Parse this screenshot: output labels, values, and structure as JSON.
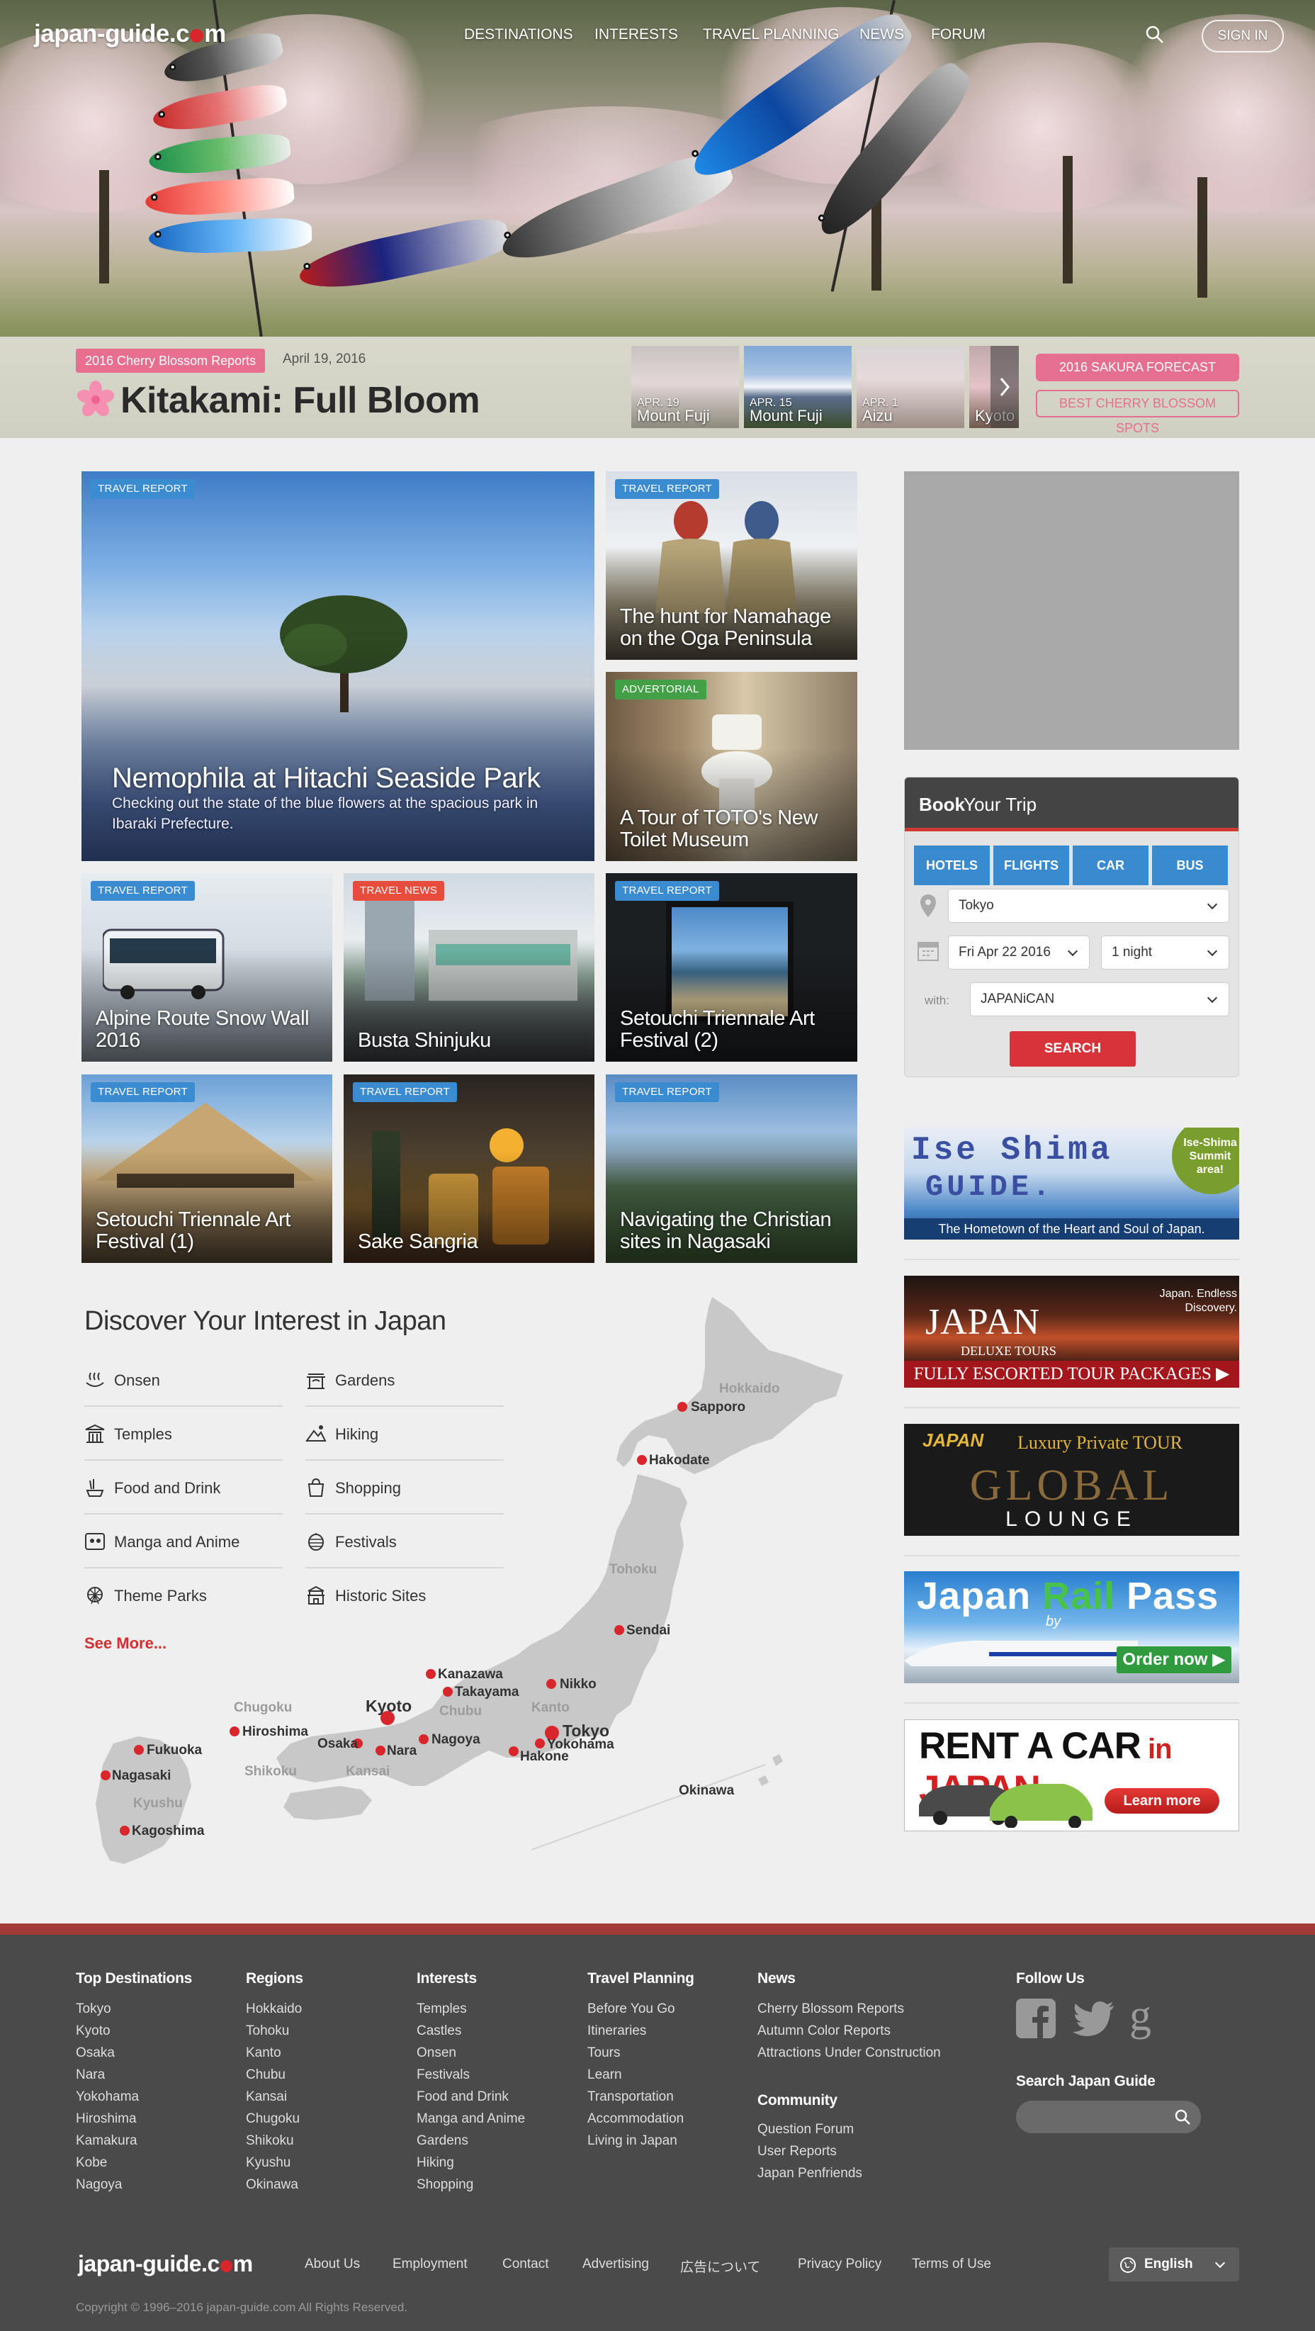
{
  "site": {
    "logo_pre": "japan-guide.c",
    "logo_post": "m",
    "brand_red": "#d8262c"
  },
  "nav": {
    "items": [
      "DESTINATIONS",
      "INTERESTS",
      "TRAVEL PLANNING",
      "NEWS",
      "FORUM"
    ],
    "search_icon": "search-icon",
    "signin": "SIGN IN"
  },
  "feature": {
    "tag": "2016 Cherry Blossom Reports",
    "date": "April 19, 2016",
    "title": "Kitakami: Full Bloom",
    "thumbs": [
      {
        "date": "APR. 19",
        "name": "Mount Fuji"
      },
      {
        "date": "APR. 15",
        "name": "Mount Fuji"
      },
      {
        "date": "APR. 1",
        "name": "Aizu"
      },
      {
        "date": "",
        "name": "Kyoto"
      }
    ],
    "btn_forecast": "2016 SAKURA FORECAST",
    "btn_spots": "BEST CHERRY BLOSSOM SPOTS",
    "accent": "#e56f90"
  },
  "articles": {
    "big": {
      "badge": "TRAVEL REPORT",
      "title": "Nemophila at Hitachi Seaside Park",
      "desc": "Checking out the state of the blue flowers at the spacious park in Ibaraki Prefecture."
    },
    "namahage": {
      "badge": "TRAVEL REPORT",
      "title": "The hunt for Namahage on the Oga Peninsula"
    },
    "toto": {
      "badge": "ADVERTORIAL",
      "title": "A Tour of TOTO's New Toilet Museum"
    },
    "alpine": {
      "badge": "TRAVEL REPORT",
      "title": "Alpine Route Snow Wall 2016"
    },
    "busta": {
      "badge": "TRAVEL NEWS",
      "title": "Busta Shinjuku"
    },
    "setouchi2": {
      "badge": "TRAVEL REPORT",
      "title": "Setouchi Triennale Art Festival (2)"
    },
    "setouchi1": {
      "badge": "TRAVEL REPORT",
      "title": "Setouchi Triennale Art Festival (1)"
    },
    "sangria": {
      "badge": "TRAVEL REPORT",
      "title": "Sake Sangria"
    },
    "christian": {
      "badge": "TRAVEL REPORT",
      "title": "Navigating the Christian sites in Nagasaki"
    }
  },
  "interests": {
    "title": "Discover Your Interest in Japan",
    "col1": [
      "Onsen",
      "Temples",
      "Food and Drink",
      "Manga and Anime",
      "Theme Parks"
    ],
    "col2": [
      "Gardens",
      "Hiking",
      "Shopping",
      "Festivals",
      "Historic Sites"
    ],
    "see_more": "See More..."
  },
  "map": {
    "cities": [
      "Sapporo",
      "Hakodate",
      "Sendai",
      "Kanazawa",
      "Takayama",
      "Nikko",
      "Kyoto",
      "Tokyo",
      "Yokohama",
      "Hakone",
      "Nagoya",
      "Osaka",
      "Nara",
      "Hiroshima",
      "Fukuoka",
      "Nagasaki",
      "Kagoshima"
    ],
    "regions": [
      "Hokkaido",
      "Tohoku",
      "Chubu",
      "Kanto",
      "Kansai",
      "Chugoku",
      "Shikoku",
      "Kyushu",
      "Okinawa"
    ]
  },
  "book": {
    "title_bold": "Book",
    "title_rest": "Your Trip",
    "tabs": [
      "HOTELS",
      "FLIGHTS",
      "CAR",
      "BUS"
    ],
    "destination": "Tokyo",
    "date": "Fri Apr 22 2016",
    "nights": "1 night",
    "with_label": "with:",
    "provider": "JAPANiCAN",
    "search": "SEARCH"
  },
  "ads": {
    "ise": {
      "line1": "Ise Shima",
      "line2": "GUIDE.",
      "sub": "The Hometown of the Heart and Soul of Japan.",
      "badge": "Ise-Shima Summit area!"
    },
    "deluxe": {
      "title": "JAPAN",
      "sub": "DELUXE TOURS",
      "tagline": "Japan. Endless Discovery.",
      "bottom": "FULLY ESCORTED TOUR PACKAGES ▶"
    },
    "global": {
      "top": "JAPAN",
      "top2": "Luxury Private TOUR",
      "mid": "GLOBAL",
      "bottom": "LOUNGE"
    },
    "railpass": {
      "title1": "Japan ",
      "title2": "Rail",
      "title3": " Pass",
      "by": "by",
      "cta": "Order now ▶"
    },
    "rentacar": {
      "t1": "RENT A CAR",
      "t2": " in ",
      "t3": "JAPAN",
      "cta": "Learn more"
    }
  },
  "footer": {
    "top_destinations": {
      "title": "Top Destinations",
      "items": [
        "Tokyo",
        "Kyoto",
        "Osaka",
        "Nara",
        "Yokohama",
        "Hiroshima",
        "Kamakura",
        "Kobe",
        "Nagoya"
      ]
    },
    "regions": {
      "title": "Regions",
      "items": [
        "Hokkaido",
        "Tohoku",
        "Kanto",
        "Chubu",
        "Kansai",
        "Chugoku",
        "Shikoku",
        "Kyushu",
        "Okinawa"
      ]
    },
    "interests": {
      "title": "Interests",
      "items": [
        "Temples",
        "Castles",
        "Onsen",
        "Festivals",
        "Food and Drink",
        "Manga and Anime",
        "Gardens",
        "Hiking",
        "Shopping"
      ]
    },
    "travel_planning": {
      "title": "Travel Planning",
      "items": [
        "Before You Go",
        "Itineraries",
        "Tours",
        "Learn",
        "Transportation",
        "Accommodation",
        "Living in Japan"
      ]
    },
    "news": {
      "title": "News",
      "items": [
        "Cherry Blossom Reports",
        "Autumn Color Reports",
        "Attractions Under Construction"
      ]
    },
    "community": {
      "title": "Community",
      "items": [
        "Question Forum",
        "User Reports",
        "Japan Penfriends"
      ]
    },
    "follow_title": "Follow Us",
    "search_title": "Search Japan Guide",
    "bottom_links": [
      "About Us",
      "Employment",
      "Contact",
      "Advertising",
      "広告について",
      "Privacy Policy",
      "Terms of Use"
    ],
    "language": "English",
    "copyright": "Copyright © 1996–2016 japan-guide.com All Rights Reserved."
  }
}
